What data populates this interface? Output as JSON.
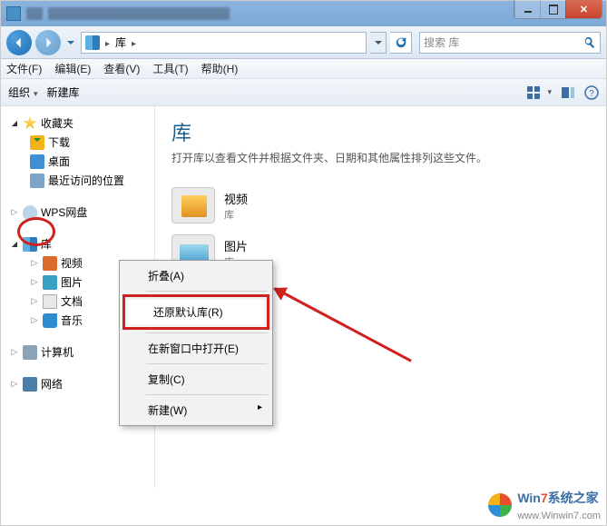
{
  "titlebar": {
    "obscured": true
  },
  "navbar": {
    "breadcrumb": {
      "root_label": "库"
    },
    "search_placeholder": "搜索 库"
  },
  "menubar": {
    "file": "文件(F)",
    "edit": "编辑(E)",
    "view": "查看(V)",
    "tools": "工具(T)",
    "help": "帮助(H)"
  },
  "toolbar": {
    "organize": "组织",
    "new_library": "新建库"
  },
  "sidebar": {
    "favorites": {
      "label": "收藏夹",
      "items": [
        {
          "icon": "dl",
          "label": "下载"
        },
        {
          "icon": "desk",
          "label": "桌面"
        },
        {
          "icon": "recent",
          "label": "最近访问的位置"
        }
      ]
    },
    "wps": {
      "label": "WPS网盘"
    },
    "libraries": {
      "label": "库",
      "items": [
        {
          "icon": "vid",
          "label": "视频"
        },
        {
          "icon": "pic",
          "label": "图片"
        },
        {
          "icon": "doc",
          "label": "文档"
        },
        {
          "icon": "mus",
          "label": "音乐"
        }
      ]
    },
    "computer": {
      "label": "计算机"
    },
    "network": {
      "label": "网络"
    }
  },
  "content": {
    "title": "库",
    "subtitle": "打开库以查看文件并根据文件夹、日期和其他属性排列这些文件。",
    "items": [
      {
        "thumb": "v",
        "name": "视频",
        "type": "库"
      },
      {
        "thumb": "p",
        "name": "图片",
        "type": "库"
      }
    ]
  },
  "context_menu": {
    "collapse": "折叠(A)",
    "restore_default": "还原默认库(R)",
    "open_new_window": "在新窗口中打开(E)",
    "copy": "复制(C)",
    "new": "新建(W)"
  },
  "watermark": {
    "brand_a": "Win",
    "brand_b": "7",
    "brand_c": "系统之家",
    "url": "www.Winwin7.com"
  }
}
